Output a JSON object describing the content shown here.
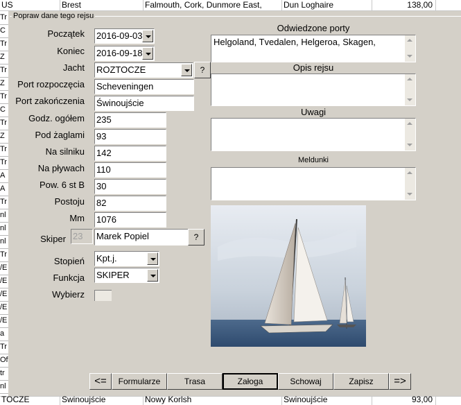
{
  "background": {
    "top_row": {
      "c1": "US",
      "c2": "Brest",
      "c3": "Falmouth, Cork, Dunmore East,",
      "c4": "Dun Loghaire",
      "c5": "138,00"
    },
    "bottom_row": {
      "c1": "TOCZE",
      "c2": "Świnoujście",
      "c3": "Nowy Korlsh",
      "c5": "Świnoujście",
      "c6": "93,00"
    },
    "left_column": [
      "Tr",
      "C",
      "Tr",
      "Z",
      "Tr",
      "Z",
      "Tr",
      "C",
      "Tr",
      "Z",
      "Tr",
      "Tr",
      "A",
      "A",
      "Tr",
      "nl",
      "nl",
      "nl",
      "Tr",
      "/E",
      "/E",
      "/E",
      "/E",
      "/E",
      "a",
      "Tr",
      "Of",
      "tr",
      "nl"
    ]
  },
  "dialog": {
    "frame_title": "Popraw dane tego rejsu",
    "fields": {
      "start_label": "Początek",
      "start_value": "2016-09-03",
      "end_label": "Koniec",
      "end_value": "2016-09-18",
      "yacht_label": "Jacht",
      "yacht_value": "ROZTOCZE",
      "port_start_label": "Port rozpoczęcia",
      "port_start_value": "Scheveningen",
      "port_end_label": "Port zakończenia",
      "port_end_value": "Świnoujście",
      "hours_total_label": "Godz. ogółem",
      "hours_total_value": "235",
      "sail_label": "Pod żaglami",
      "sail_value": "93",
      "engine_label": "Na silniku",
      "engine_value": "142",
      "floating_label": "Na pływach",
      "floating_value": "110",
      "pow6_label": "Pow. 6 st B",
      "pow6_value": "30",
      "stop_label": "Postoju",
      "stop_value": "82",
      "mm_label": "Mm",
      "mm_value": "1076",
      "skipper_label": "Skiper",
      "skipper_id": "23",
      "skipper_value": "Marek Popiel",
      "rank_label": "Stopień",
      "rank_value": "Kpt.j.",
      "function_label": "Funkcja",
      "function_value": "SKIPER",
      "select_label": "Wybierz"
    },
    "help_button": "?",
    "sections": {
      "ports_title": "Odwiedzone porty",
      "ports_value": "Helgoland, Tvedalen, Helgeroa, Skagen,",
      "description_title": "Opis rejsu",
      "notes_title": "Uwagi",
      "reports_title": "Meldunki"
    },
    "buttons": {
      "prev": "<=",
      "forms": "Formularze",
      "route": "Trasa",
      "crew": "Załoga",
      "hide": "Schowaj",
      "save": "Zapisz",
      "next": "=>"
    }
  }
}
